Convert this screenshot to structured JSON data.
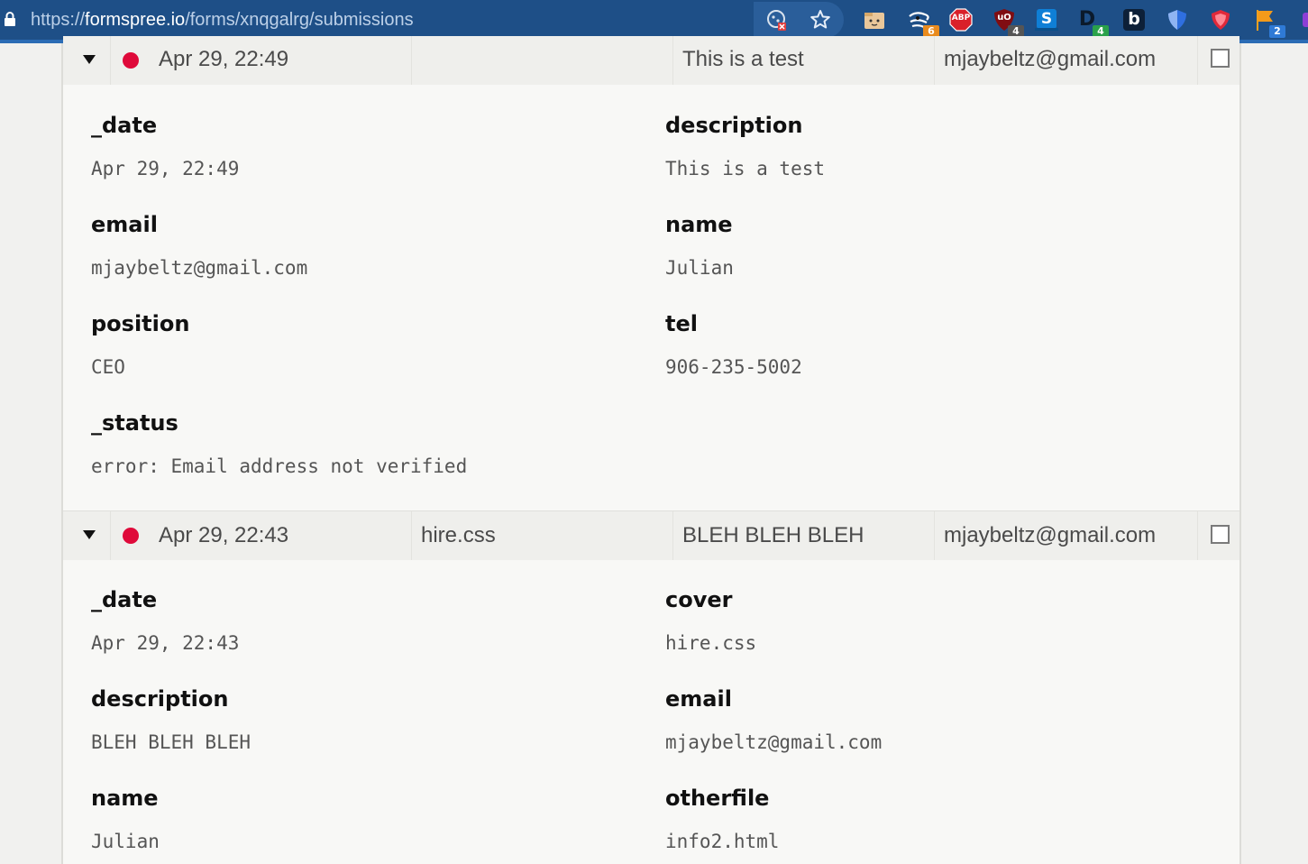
{
  "browser": {
    "url_scheme": "https://",
    "url_host": "formspree.io",
    "url_path": "/forms/xnqgalrg/submissions",
    "extensions": [
      {
        "name": "cookie-blocked-icon",
        "badge": ""
      },
      {
        "name": "bookmark-star-icon",
        "badge": ""
      },
      {
        "name": "folder-face-icon",
        "badge": ""
      },
      {
        "name": "wind-extension-icon",
        "badge": "6"
      },
      {
        "name": "adblock-plus-icon",
        "label": "ABP",
        "badge": ""
      },
      {
        "name": "ublock-origin-icon",
        "label": "uO",
        "badge": "4"
      },
      {
        "name": "s-extension-icon",
        "label": "S",
        "badge": ""
      },
      {
        "name": "d-extension-icon",
        "label": "D",
        "badge": "4"
      },
      {
        "name": "b-extension-icon",
        "label": "b",
        "badge": ""
      },
      {
        "name": "blue-shield-icon",
        "badge": ""
      },
      {
        "name": "red-shield-icon",
        "badge": ""
      },
      {
        "name": "flag-extension-icon",
        "badge": "2"
      }
    ]
  },
  "submissions": [
    {
      "row": {
        "date": "Apr 29, 22:49",
        "col2": "",
        "col3": "This is a test",
        "col4": "mjaybeltz@gmail.com"
      },
      "fields": [
        {
          "label": "_date",
          "value": "Apr 29, 22:49"
        },
        {
          "label": "description",
          "value": "This is a test"
        },
        {
          "label": "email",
          "value": "mjaybeltz@gmail.com"
        },
        {
          "label": "name",
          "value": "Julian"
        },
        {
          "label": "position",
          "value": "CEO"
        },
        {
          "label": "tel",
          "value": "906-235-5002"
        },
        {
          "label": "_status",
          "value": "error: Email address not verified"
        }
      ]
    },
    {
      "row": {
        "date": "Apr 29, 22:43",
        "col2": "hire.css",
        "col3": "BLEH BLEH BLEH",
        "col4": "mjaybeltz@gmail.com"
      },
      "fields": [
        {
          "label": "_date",
          "value": "Apr 29, 22:43"
        },
        {
          "label": "cover",
          "value": "hire.css"
        },
        {
          "label": "description",
          "value": "BLEH BLEH BLEH"
        },
        {
          "label": "email",
          "value": "mjaybeltz@gmail.com"
        },
        {
          "label": "name",
          "value": "Julian"
        },
        {
          "label": "otherfile",
          "value": "info2.html"
        }
      ]
    }
  ],
  "colors": {
    "browser_bar": "#1e4f87",
    "status_dot": "#df0a3a",
    "panel_bg": "#f8f8f6"
  }
}
